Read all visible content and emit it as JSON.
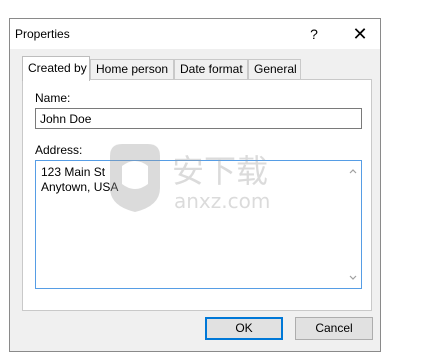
{
  "window": {
    "title": "Properties",
    "help_glyph": "?",
    "close_glyph": "✕"
  },
  "tabs": [
    {
      "label": "Created by",
      "active": true
    },
    {
      "label": "Home person",
      "active": false
    },
    {
      "label": "Date format",
      "active": false
    },
    {
      "label": "General",
      "active": false
    }
  ],
  "form": {
    "name_label": "Name:",
    "name_value": "John Doe",
    "address_label": "Address:",
    "address_lines": [
      "123 Main St",
      "Anytown, USA"
    ]
  },
  "buttons": {
    "ok": "OK",
    "cancel": "Cancel"
  },
  "watermark": {
    "text": "安下载",
    "subtext": "anxz.com"
  },
  "colors": {
    "accent": "#0078d7",
    "focus_border": "#569de5",
    "dialog_bg": "#f0f0f0"
  }
}
